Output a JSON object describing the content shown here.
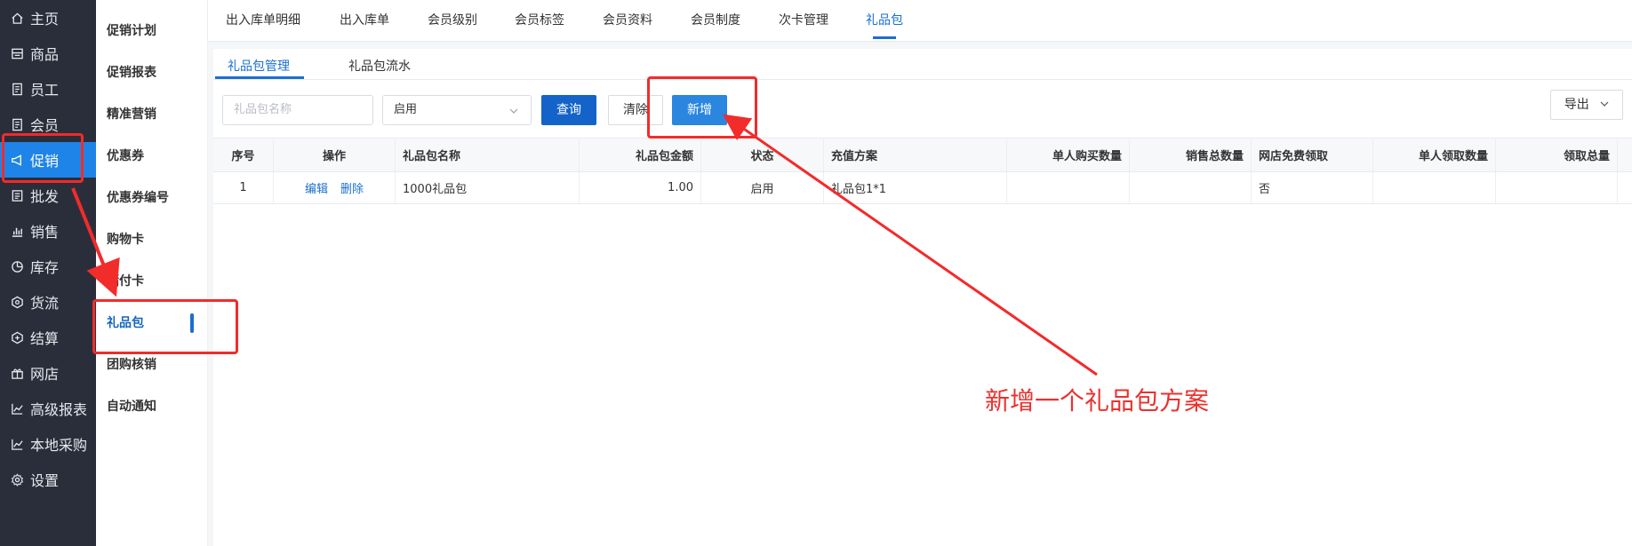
{
  "nav": {
    "items": [
      {
        "label": "主页",
        "icon": "home-icon"
      },
      {
        "label": "商品",
        "icon": "goods-icon"
      },
      {
        "label": "员工",
        "icon": "document-icon"
      },
      {
        "label": "会员",
        "icon": "document-icon"
      },
      {
        "label": "促销",
        "icon": "megaphone-icon"
      },
      {
        "label": "批发",
        "icon": "list-icon"
      },
      {
        "label": "销售",
        "icon": "bar-chart-icon"
      },
      {
        "label": "库存",
        "icon": "pie-chart-icon"
      },
      {
        "label": "货流",
        "icon": "flow-icon"
      },
      {
        "label": "结算",
        "icon": "settle-icon"
      },
      {
        "label": "网店",
        "icon": "gift-icon"
      },
      {
        "label": "高级报表",
        "icon": "line-chart-icon"
      },
      {
        "label": "本地采购",
        "icon": "line-chart-icon"
      },
      {
        "label": "设置",
        "icon": "gear-icon"
      }
    ],
    "active_index": 4
  },
  "submenu": {
    "items": [
      "促销计划",
      "促销报表",
      "精准营销",
      "优惠券",
      "优惠券编号",
      "购物卡",
      "储付卡",
      "礼品包",
      "团购核销",
      "自动通知"
    ],
    "active_index": 7
  },
  "topbar": {
    "tabs": [
      "出入库单明细",
      "出入库单",
      "会员级别",
      "会员标签",
      "会员资料",
      "会员制度",
      "次卡管理",
      "礼品包"
    ],
    "active_index": 7
  },
  "subtabs": {
    "tabs": [
      "礼品包管理",
      "礼品包流水"
    ],
    "active_index": 0
  },
  "filters": {
    "name_placeholder": "礼品包名称",
    "status_value": "启用",
    "query_label": "查询",
    "clear_label": "清除",
    "add_label": "新增",
    "export_label": "导出"
  },
  "table": {
    "headers": [
      "序号",
      "操作",
      "礼品包名称",
      "礼品包金额",
      "状态",
      "充值方案",
      "单人购买数量",
      "销售总数量",
      "网店免费领取",
      "单人领取数量",
      "领取总量"
    ],
    "rows": [
      {
        "index": "1",
        "edit": "编辑",
        "delete": "删除",
        "name": "1000礼品包",
        "amount": "1.00",
        "status": "启用",
        "plan": "礼品包1*1",
        "per_person_buy": "",
        "total_sold": "",
        "free_online": "否",
        "per_person_receive": "",
        "total_receive": ""
      }
    ]
  },
  "annotation": {
    "text": "新增一个礼品包方案",
    "color": "#e8322f"
  },
  "colors": {
    "nav_bg": "#2a2e3a",
    "nav_active": "#1f84e8",
    "accent": "#1a6fd0",
    "primary_button": "#1463c8",
    "annotation_red": "#f22b2b"
  }
}
